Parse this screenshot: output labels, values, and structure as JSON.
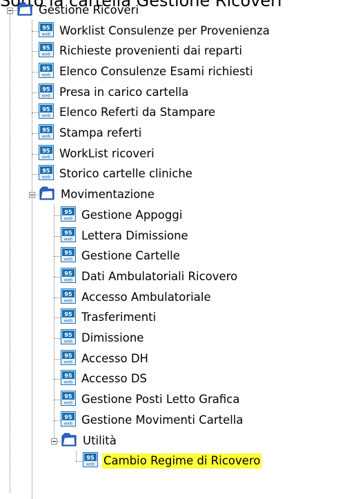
{
  "page_heading": "Sotto la cartella Gestione Ricoveri",
  "tree": {
    "root": {
      "label": "Gestione Ricoveri",
      "items": [
        "Worklist Consulenze per Provenienza",
        "Richieste provenienti dai reparti",
        "Elenco Consulenze Esami richiesti",
        "Presa in carico cartella",
        "Elenco Referti da Stampare",
        "Stampa referti",
        "WorkList ricoveri",
        "Storico cartelle cliniche"
      ]
    },
    "movimentazione": {
      "label": "Movimentazione",
      "items": [
        "Gestione Appoggi",
        "Lettera Dimissione",
        "Gestione Cartelle",
        "Dati Ambulatoriali Ricovero",
        "Accesso Ambulatoriale",
        "Trasferimenti",
        "Dimissione",
        "Accesso DH",
        "Accesso DS",
        "Gestione Posti Letto Grafica",
        "Gestione  Movimenti Cartella"
      ]
    },
    "utilita": {
      "label": "Utilità",
      "items": [
        "Cambio Regime di Ricovero"
      ],
      "selected_index": 0
    }
  },
  "colors": {
    "selection_highlight": "#ffff3a",
    "page_icon_blue": "#1a6fb0",
    "folder_blue": "#2d63c8"
  },
  "icons": {
    "folder": "folder-icon",
    "page": "web-page-icon",
    "expander": "collapse-toggle-icon"
  }
}
